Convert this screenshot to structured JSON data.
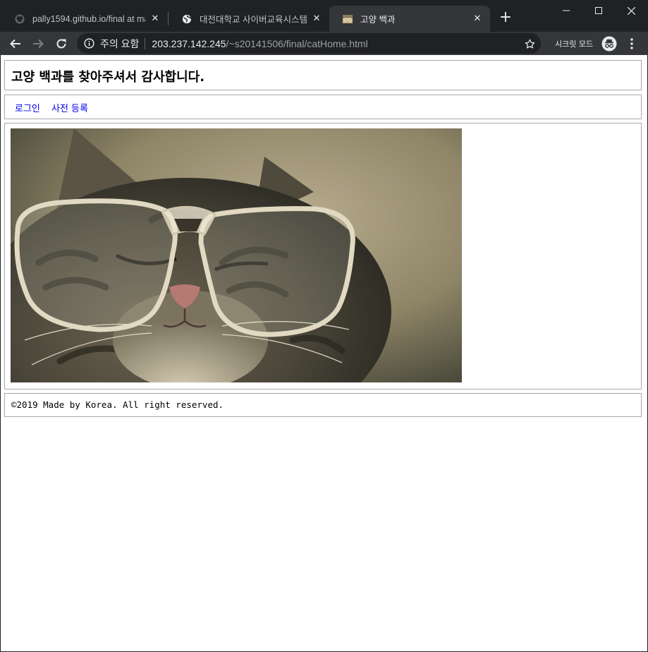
{
  "browser": {
    "tabs": [
      {
        "title": "pally1594.github.io/final at ma",
        "favicon": "github-icon",
        "active": false
      },
      {
        "title": "대전대학교 사이버교육시스템",
        "favicon": "globe-icon",
        "active": false
      },
      {
        "title": "고양 백과",
        "favicon": "cat-thumbnail-icon",
        "active": true
      }
    ],
    "new_tab_label": "+",
    "security_label": "주의 요함",
    "url_host": "203.237.142.245",
    "url_path": "/~s20141506/final/catHome.html",
    "incognito_label": "시크릿 모드",
    "colors": {
      "frame": "#202124",
      "toolbar": "#35363a",
      "link": "#0000ee",
      "border": "#a9a9a9"
    }
  },
  "page": {
    "title": "고양 백과를 찾아주셔서 감사합니다.",
    "nav": {
      "login": "로그인",
      "register": "사전 등록"
    },
    "image_subject": "cat-wearing-glasses-photo",
    "footer": "©2019 Made by Korea. All right reserved."
  }
}
